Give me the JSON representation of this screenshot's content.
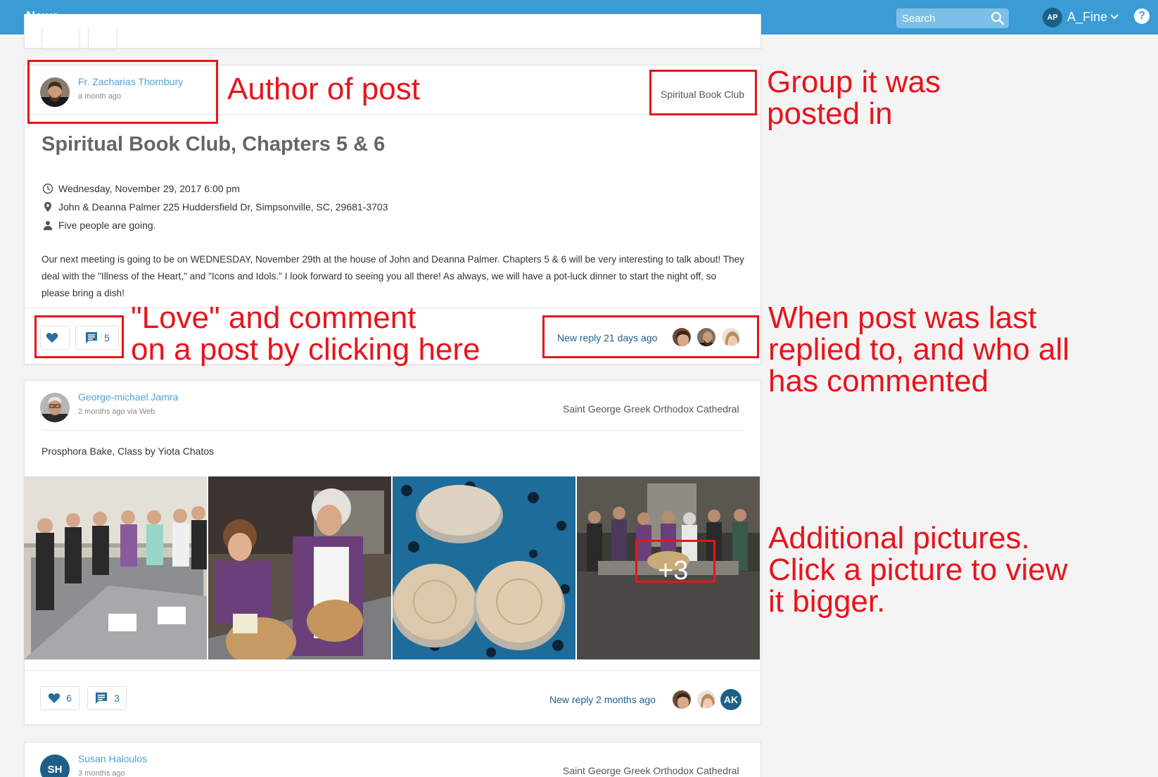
{
  "topbar": {
    "title": "News",
    "search_placeholder": "Search",
    "user_initials": "AP",
    "user_name": "A_Fine",
    "help_symbol": "?"
  },
  "post1": {
    "author": "Fr. Zacharias Thornbury",
    "time": "a month ago",
    "group": "Spiritual Book Club",
    "title": "Spiritual Book Club, Chapters 5 & 6",
    "datetime": "Wednesday, November 29, 2017 6:00 pm",
    "location": "John & Deanna Palmer  225 Huddersfield Dr, Simpsonville, SC, 29681-3703",
    "attendance": "Five people are going.",
    "body": "Our next meeting is going to be on WEDNESDAY, November 29th at the house of John and Deanna Palmer. Chapters 5 & 6 will be very interesting to talk about! They deal with the \"Illness of the Heart,\" and \"Icons and Idols.\" I look forward to seeing you all there! As always, we will have a pot-luck dinner to start the night off, so please bring a dish!",
    "love_count": "",
    "comment_count": "5",
    "last_reply": "New reply 21 days ago"
  },
  "post2": {
    "author": "George-michael Jamra",
    "time": "2 months ago via Web",
    "group": "Saint George Greek Orthodox Cathedral",
    "text": "Prosphora Bake, Class by Yiota Chatos",
    "more_photos": "+3",
    "love_count": "6",
    "comment_count": "3",
    "last_reply": "New reply 2 months ago",
    "commenter_initials": "AK"
  },
  "post3": {
    "author": "Susan Haloulos",
    "initials": "SH",
    "time": "3 months ago",
    "group": "Saint George Greek Orthodox Cathedral"
  },
  "annotations": {
    "author": "Author of post",
    "group": "Group it was\nposted in",
    "love": "\"Love\" and comment\non a post by clicking here",
    "reply": "When post was last\nreplied to, and who all\nhas commented",
    "pictures": "Additional pictures.\nClick a picture to view\nit bigger."
  },
  "colors": {
    "topbar": "#3a9bd5",
    "link": "#4aa3d8",
    "annotation": "#e8141c",
    "avatar_dark": "#1e5f86"
  }
}
